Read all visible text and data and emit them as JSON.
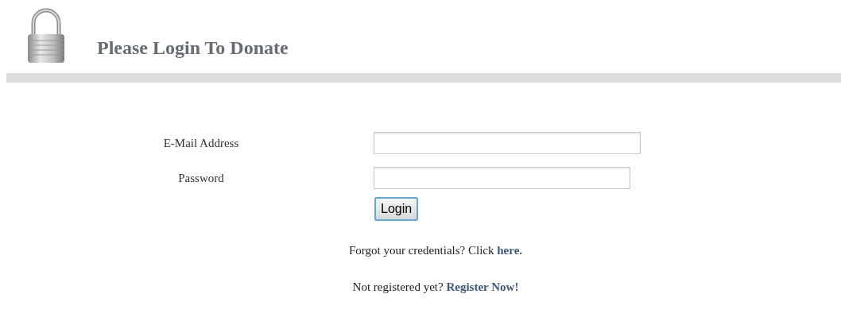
{
  "header": {
    "title": "Please Login To Donate"
  },
  "form": {
    "fields": [
      {
        "label": "E-Mail Address",
        "kind": "email"
      },
      {
        "label": "Password",
        "kind": "password"
      }
    ],
    "button": "Login"
  },
  "links": [
    {
      "text": "Forgot your credentials? Click ",
      "link": "here."
    },
    {
      "text": "Not registered yet? ",
      "link": "Register Now!"
    }
  ]
}
